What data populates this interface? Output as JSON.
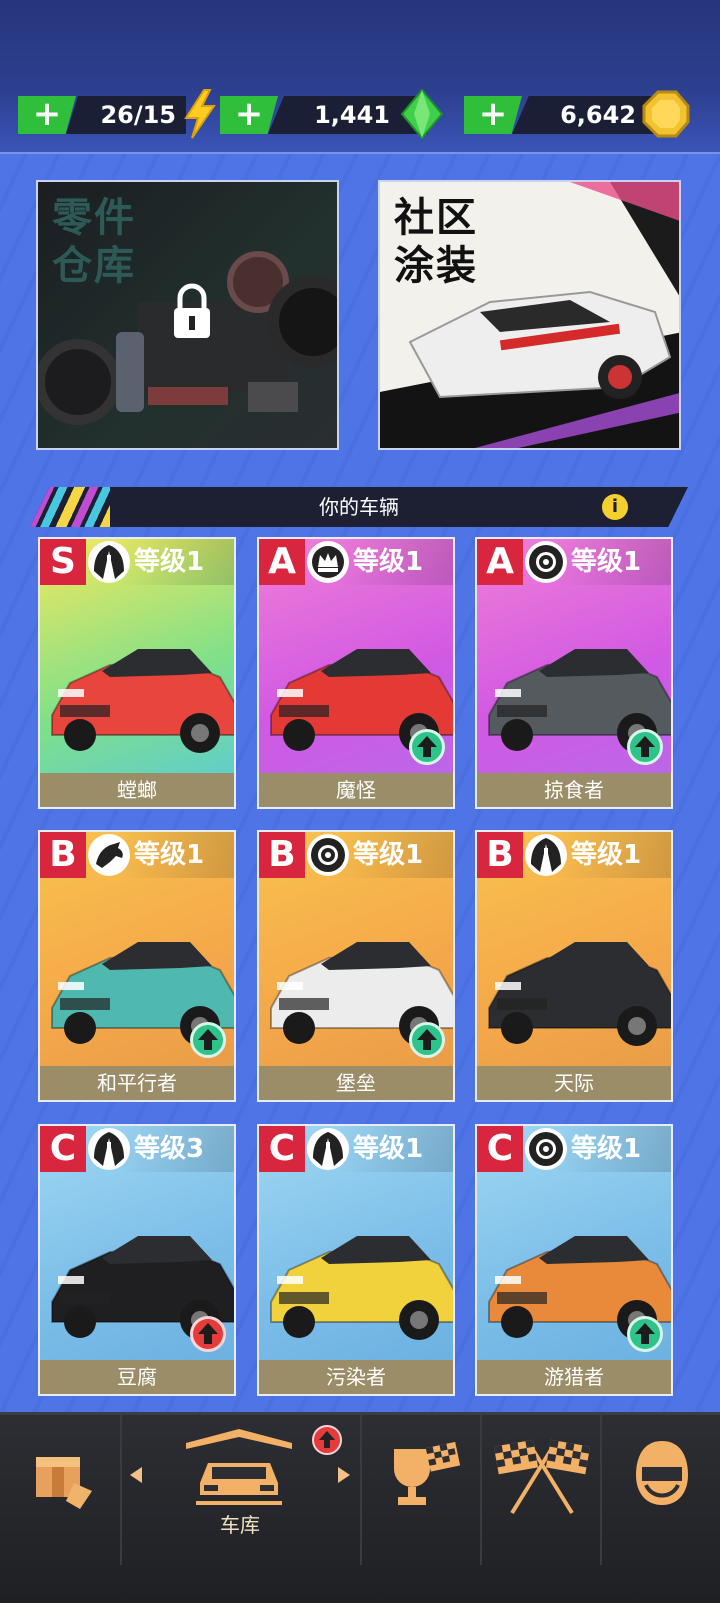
{
  "resources": {
    "energy": {
      "value": "26/15",
      "icon": "lightning-icon"
    },
    "gems": {
      "value": "1,441",
      "icon": "gem-icon"
    },
    "coins": {
      "value": "6,642",
      "icon": "coin-icon"
    }
  },
  "panels": {
    "parts": {
      "title_line1": "零件",
      "title_line2": "仓库",
      "locked": true
    },
    "livery": {
      "title_line1": "社区",
      "title_line2": "涂装"
    }
  },
  "section": {
    "title": "你的车辆",
    "info": "i"
  },
  "cars": [
    {
      "grade": "S",
      "class_icon": "road-icon",
      "level": "等级1",
      "name": "螳螂",
      "upgrade": false,
      "colors": [
        "#f4e85c",
        "#7fe08a",
        "#59c9d9"
      ]
    },
    {
      "grade": "A",
      "class_icon": "crown-icon",
      "level": "等级1",
      "name": "魔怪",
      "upgrade": true,
      "colors": [
        "#ef7fd6",
        "#d159e3",
        "#b56ae9"
      ]
    },
    {
      "grade": "A",
      "class_icon": "wheel-icon",
      "level": "等级1",
      "name": "掠食者",
      "upgrade": true,
      "colors": [
        "#ef7fd6",
        "#d159e3",
        "#b56ae9"
      ]
    },
    {
      "grade": "B",
      "class_icon": "horse-icon",
      "level": "等级1",
      "name": "和平行者",
      "upgrade": true,
      "colors": [
        "#f8c24e",
        "#f5a84a",
        "#e69a47"
      ]
    },
    {
      "grade": "B",
      "class_icon": "wheel-icon",
      "level": "等级1",
      "name": "堡垒",
      "upgrade": true,
      "colors": [
        "#f8c24e",
        "#f5a84a",
        "#e69a47"
      ]
    },
    {
      "grade": "B",
      "class_icon": "road-icon",
      "level": "等级1",
      "name": "天际",
      "upgrade": false,
      "colors": [
        "#f8c24e",
        "#f5a84a",
        "#e69a47"
      ]
    },
    {
      "grade": "C",
      "class_icon": "road-icon",
      "level": "等级3",
      "name": "豆腐",
      "upgrade": true,
      "upgrade_color": "red",
      "colors": [
        "#9fd7f3",
        "#7bbde8",
        "#69aee0"
      ]
    },
    {
      "grade": "C",
      "class_icon": "road-icon",
      "level": "等级1",
      "name": "污染者",
      "upgrade": false,
      "colors": [
        "#9fd7f3",
        "#7bbde8",
        "#69aee0"
      ]
    },
    {
      "grade": "C",
      "class_icon": "wheel-icon",
      "level": "等级1",
      "name": "游猎者",
      "upgrade": true,
      "colors": [
        "#9fd7f3",
        "#7bbde8",
        "#69aee0"
      ]
    }
  ],
  "nav": {
    "tabs": [
      {
        "name": "shop",
        "icon": "box-icon",
        "label": ""
      },
      {
        "name": "garage",
        "icon": "car-icon",
        "label": "车库",
        "active": true,
        "badge": "upgrade"
      },
      {
        "name": "cup",
        "icon": "trophy-icon",
        "label": ""
      },
      {
        "name": "race",
        "icon": "checkered-flags-icon",
        "label": ""
      },
      {
        "name": "profile",
        "icon": "helmet-icon",
        "label": ""
      }
    ]
  }
}
